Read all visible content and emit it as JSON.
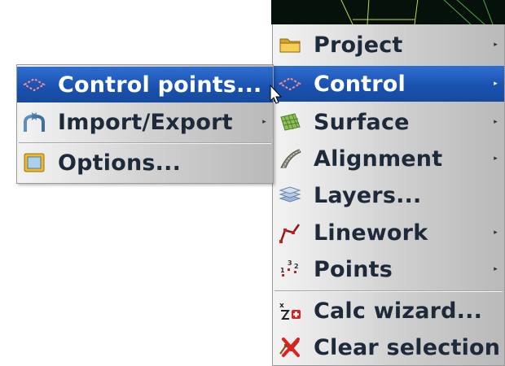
{
  "main_menu": {
    "items": [
      {
        "label": "Project",
        "icon": "folder-icon",
        "submenu": true
      },
      {
        "label": "Control",
        "icon": "control-diamond-icon",
        "submenu": true
      },
      {
        "label": "Surface",
        "icon": "surface-mesh-icon",
        "submenu": true
      },
      {
        "label": "Alignment",
        "icon": "alignment-road-icon",
        "submenu": true
      },
      {
        "label": "Layers...",
        "icon": "layers-icon",
        "submenu": false
      },
      {
        "label": "Linework",
        "icon": "linework-icon",
        "submenu": true
      },
      {
        "label": "Points",
        "icon": "points-icon",
        "submenu": true
      },
      {
        "label": "Calc wizard...",
        "icon": "calc-wizard-icon",
        "submenu": false
      },
      {
        "label": "Clear selection",
        "icon": "clear-selection-icon",
        "submenu": false
      }
    ],
    "selected": "Control"
  },
  "sub_menu": {
    "items": [
      {
        "label": "Control points...",
        "icon": "control-diamond-icon",
        "submenu": false
      },
      {
        "label": "Import/Export",
        "icon": "import-export-icon",
        "submenu": true
      },
      {
        "label": "Options...",
        "icon": "options-icon",
        "submenu": false
      }
    ],
    "selected": "Control points..."
  },
  "submenu_arrow": "▸",
  "colors": {
    "selection": "#1a52b0",
    "menu_text": "#1e2a3a",
    "canvas_background": "#05110a",
    "canvas_lines": "#c9d84a"
  }
}
